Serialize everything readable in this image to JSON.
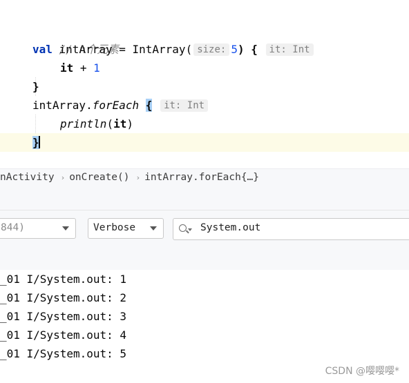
{
  "editor": {
    "comment": "// n个元素",
    "line2": {
      "kw": "val",
      "name": " intArray = IntArray(",
      "hint_size": "size:",
      "num": "5",
      "after": ") {",
      "hint_type": "it: Int"
    },
    "line3": {
      "it": "it",
      "op": " + ",
      "num": "1"
    },
    "line4": "}",
    "line5": {
      "receiver": "intArray.",
      "fn": "forEach",
      "brace": "{",
      "hint_type": "it: Int"
    },
    "line6": {
      "fn": "println",
      "open": "(",
      "arg": "it",
      "close": ")"
    },
    "line7": "}"
  },
  "breadcrumb": {
    "items": [
      "nActivity",
      "onCreate()",
      "intArray.forEach{…}"
    ],
    "separator": "›"
  },
  "logcat": {
    "process_value": "844)",
    "level_value": "Verbose",
    "filter_value": "System.out",
    "lines": [
      "_01 I/System.out: 1",
      "_01 I/System.out: 2",
      "_01 I/System.out: 3",
      "_01 I/System.out: 4",
      "_01 I/System.out: 5"
    ]
  },
  "watermark": "CSDN @嘤嘤嘤*",
  "icons": {
    "search": "search-icon",
    "dropdown": "chevron-down-icon"
  },
  "colors": {
    "keyword": "#0033b3",
    "number": "#1750eb",
    "comment": "#8c8c8c",
    "current_line": "#fdfbe7",
    "brace_highlight": "#a9d0f5"
  }
}
